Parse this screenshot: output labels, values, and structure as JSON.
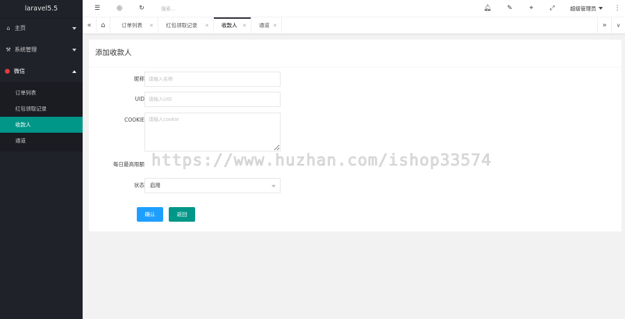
{
  "app": {
    "logo": "laravel5.5"
  },
  "sidebar": {
    "items": [
      {
        "label": "主页",
        "icon": "home-icon"
      },
      {
        "label": "系统管理",
        "icon": "settings-icon"
      },
      {
        "label": "微信",
        "icon": "wechat-icon"
      }
    ],
    "subitems": [
      {
        "label": "订单列表"
      },
      {
        "label": "红包领取记录"
      },
      {
        "label": "收款人"
      },
      {
        "label": "通道"
      }
    ]
  },
  "header": {
    "search_placeholder": "搜索...",
    "admin_label": "超级管理员"
  },
  "tabs": [
    {
      "label": "订单列表"
    },
    {
      "label": "红包领取记录"
    },
    {
      "label": "收款人"
    },
    {
      "label": "通道"
    }
  ],
  "form": {
    "title": "添加收款人",
    "nickname_label": "昵称",
    "nickname_placeholder": "请输入名称",
    "uid_label": "UID",
    "uid_placeholder": "请输入UID",
    "cookie_label": "COOKIE",
    "cookie_placeholder": "请输入cookie",
    "daily_limit_label": "每日最高限额",
    "status_label": "状态",
    "status_value": "启用",
    "confirm_label": "确认",
    "back_label": "返回"
  },
  "watermark": "https://www.huzhan.com/ishop33574",
  "colors": {
    "sidebar_bg": "#20222a",
    "active_green": "#009688",
    "confirm_blue": "#1e9fff",
    "wechat_red": "#e23c3c"
  }
}
